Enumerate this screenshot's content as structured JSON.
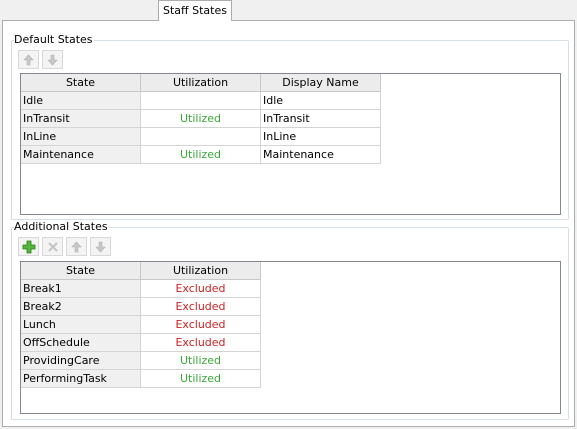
{
  "tab": {
    "label": "Staff States"
  },
  "default_states": {
    "title": "Default States",
    "columns": [
      "State",
      "Utilization",
      "Display Name"
    ],
    "rows": [
      {
        "state": "Idle",
        "utilization": "",
        "display_name": "Idle"
      },
      {
        "state": "InTransit",
        "utilization": "Utilized",
        "display_name": "InTransit"
      },
      {
        "state": "InLine",
        "utilization": "",
        "display_name": "InLine"
      },
      {
        "state": "Maintenance",
        "utilization": "Utilized",
        "display_name": "Maintenance"
      }
    ],
    "toolbar_icons": [
      "move-up-icon",
      "move-down-icon"
    ]
  },
  "additional_states": {
    "title": "Additional States",
    "columns": [
      "State",
      "Utilization"
    ],
    "rows": [
      {
        "state": "Break1",
        "utilization": "Excluded"
      },
      {
        "state": "Break2",
        "utilization": "Excluded"
      },
      {
        "state": "Lunch",
        "utilization": "Excluded"
      },
      {
        "state": "OffSchedule",
        "utilization": "Excluded"
      },
      {
        "state": "ProvidingCare",
        "utilization": "Utilized"
      },
      {
        "state": "PerformingTask",
        "utilization": "Utilized"
      }
    ],
    "toolbar_icons": [
      "add-icon",
      "delete-icon",
      "move-up-icon",
      "move-down-icon"
    ]
  },
  "colors": {
    "utilized": "#3aa83a",
    "excluded": "#cc2222",
    "add": "#3c9a2a"
  }
}
